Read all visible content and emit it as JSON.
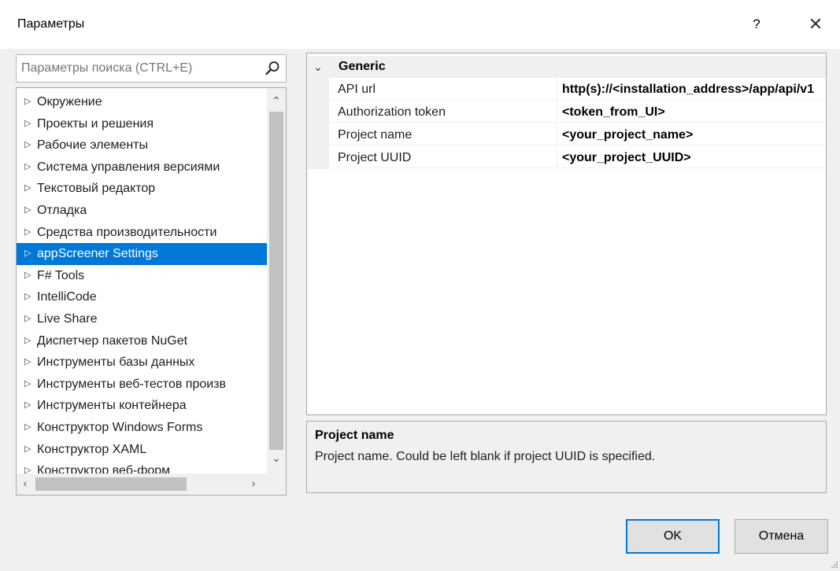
{
  "window": {
    "title": "Параметры",
    "help_label": "?",
    "close_label": "✕"
  },
  "search": {
    "placeholder": "Параметры поиска (CTRL+E)",
    "icon": "search-icon"
  },
  "tree": {
    "items": [
      {
        "label": "Окружение",
        "selected": false
      },
      {
        "label": "Проекты и решения",
        "selected": false
      },
      {
        "label": "Рабочие элементы",
        "selected": false
      },
      {
        "label": "Система управления версиями",
        "selected": false
      },
      {
        "label": "Текстовый редактор",
        "selected": false
      },
      {
        "label": "Отладка",
        "selected": false
      },
      {
        "label": "Средства производительности",
        "selected": false
      },
      {
        "label": "appScreener Settings",
        "selected": true
      },
      {
        "label": "F# Tools",
        "selected": false
      },
      {
        "label": "IntelliCode",
        "selected": false
      },
      {
        "label": "Live Share",
        "selected": false
      },
      {
        "label": "Диспетчер пакетов NuGet",
        "selected": false
      },
      {
        "label": "Инструменты базы данных",
        "selected": false
      },
      {
        "label": "Инструменты веб-тестов произв",
        "selected": false
      },
      {
        "label": "Инструменты контейнера",
        "selected": false
      },
      {
        "label": "Конструктор Windows Forms",
        "selected": false
      },
      {
        "label": "Конструктор XAML",
        "selected": false
      },
      {
        "label": "Конструктор веб-форм",
        "selected": false
      }
    ]
  },
  "properties": {
    "category": "Generic",
    "rows": [
      {
        "name": "API url",
        "value": "http(s)://<installation_address>/app/api/v1"
      },
      {
        "name": "Authorization token",
        "value": "<token_from_UI>"
      },
      {
        "name": "Project name",
        "value": "<your_project_name>"
      },
      {
        "name": "Project UUID",
        "value": "<your_project_UUID>"
      }
    ]
  },
  "description": {
    "title": "Project name",
    "text": "Project name. Could be left blank if project UUID is specified."
  },
  "buttons": {
    "ok": "OK",
    "cancel": "Отмена"
  },
  "colors": {
    "selection": "#0078d7",
    "window_bg": "#f0f0f0"
  }
}
